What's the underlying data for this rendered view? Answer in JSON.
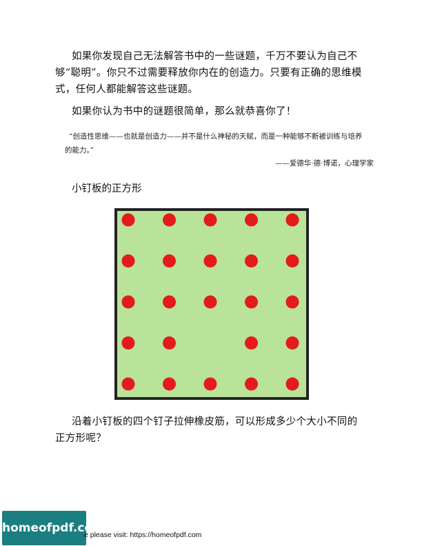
{
  "paragraphs": {
    "p1": "如果你发现自己无法解答书中的一些谜题，千万不要认为自己不够“聪明”。你只不过需要释放你内在的创造力。只要有正确的思维模式，任何人都能解答这些谜题。",
    "p2": "如果你认为书中的谜题很简单，那么就恭喜你了！",
    "quote": "“创造性思维——也就是创造力——并不是什么神秘的天赋，而是一种能够不断被训练与培养的能力。”",
    "attribution": "——爱德华·德·博诺，心理学家",
    "subtitle": "小钉板的正方形",
    "question": "沿着小钉板的四个钉子拉伸橡皮筋，可以形成多少个大小不同的正方形呢？"
  },
  "pegboard": {
    "board_color": "#b9e29a",
    "border_color": "#222222",
    "peg_color": "#e31b1b",
    "grid_rows": 5,
    "grid_cols": 5,
    "missing_pegs": [
      [
        3,
        2
      ]
    ]
  },
  "footer": {
    "logo_text": "homeofpdf.com",
    "text": "e please visit: https://homeofpdf.com"
  }
}
